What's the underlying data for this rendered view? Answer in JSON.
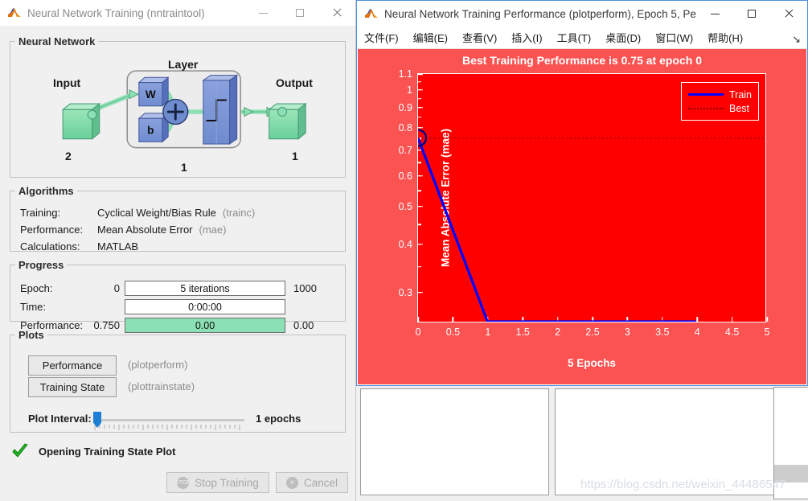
{
  "left_window": {
    "title": "Neural Network Training (nntraintool)",
    "icon": "matlab-icon",
    "controls": {
      "minimize": "—",
      "maximize": "□",
      "close": "✕"
    },
    "nn_group": {
      "legend": "Neural Network",
      "layer_label": "Layer",
      "input_label": "Input",
      "input_count": "2",
      "output_label": "Output",
      "output_count": "1",
      "weight_label": "W",
      "bias_label": "b",
      "sum_label": "+",
      "layer_count": "1"
    },
    "algorithms": {
      "legend": "Algorithms",
      "rows": [
        {
          "label": "Training:",
          "value": "Cyclical Weight/Bias Rule",
          "fn": "(trainc)"
        },
        {
          "label": "Performance:",
          "value": "Mean Absolute Error",
          "fn": "(mae)"
        },
        {
          "label": "Calculations:",
          "value": "MATLAB",
          "fn": ""
        }
      ]
    },
    "progress": {
      "legend": "Progress",
      "rows": [
        {
          "label": "Epoch:",
          "left": "0",
          "bar": "5 iterations",
          "right": "1000",
          "filled": false
        },
        {
          "label": "Time:",
          "left": "",
          "bar": "0:00:00",
          "right": "",
          "filled": false
        },
        {
          "label": "Performance:",
          "left": "0.750",
          "bar": "0.00",
          "right": "0.00",
          "filled": true
        }
      ]
    },
    "plots": {
      "legend": "Plots",
      "buttons": [
        {
          "label": "Performance",
          "fn": "(plotperform)"
        },
        {
          "label": "Training State",
          "fn": "(plottrainstate)"
        }
      ],
      "interval_label": "Plot Interval:",
      "interval_value": "1 epochs"
    },
    "status": {
      "icon": "green-check-icon",
      "text": "Opening Training State Plot"
    },
    "bottom_buttons": [
      {
        "label": "Stop Training",
        "icon": "stop-icon",
        "enabled": false
      },
      {
        "label": "Cancel",
        "icon": "cancel-icon",
        "enabled": false
      }
    ]
  },
  "right_window": {
    "title": "Neural Network Training Performance (plotperform), Epoch 5, Pe...",
    "icon": "matlab-icon",
    "controls": {
      "minimize": "—",
      "maximize": "□",
      "close": "✕"
    },
    "menu": [
      "文件(F)",
      "编辑(E)",
      "查看(V)",
      "插入(I)",
      "工具(T)",
      "桌面(D)",
      "窗口(W)",
      "帮助(H)"
    ],
    "menu_overflow": "↘"
  },
  "chart_data": {
    "type": "line",
    "title": "Best Training Performance is 0.75 at epoch 0",
    "xlabel": "5 Epochs",
    "ylabel": "Mean Absolute Error  (mae)",
    "xlim": [
      0,
      5
    ],
    "ylim": [
      0.25,
      1.1
    ],
    "yscale": "log",
    "xticks": [
      "0",
      "0.5",
      "1",
      "1.5",
      "2",
      "2.5",
      "3",
      "3.5",
      "4",
      "4.5",
      "5"
    ],
    "xtick_values": [
      0,
      0.5,
      1,
      1.5,
      2,
      2.5,
      3,
      3.5,
      4,
      4.5,
      5
    ],
    "yticks": [
      "0.3",
      "0.4",
      "0.5",
      "0.6",
      "0.7",
      "0.8",
      "0.9",
      "1",
      "1.1"
    ],
    "ytick_values": [
      0.3,
      0.4,
      0.5,
      0.6,
      0.7,
      0.8,
      0.9,
      1.0,
      1.1
    ],
    "grid": false,
    "legend_position": "upper-right",
    "plot_bg_color": "#ff0000",
    "figure_bg_color": "#fb5252",
    "series": [
      {
        "name": "Train",
        "color": "#0000ff",
        "style": "solid",
        "x": [
          0,
          1,
          2,
          3,
          4
        ],
        "y": [
          0.75,
          0.25,
          0.25,
          0.25,
          0.25
        ]
      },
      {
        "name": "Best",
        "color": "#8b0000",
        "style": "dotted",
        "x": [
          0,
          5
        ],
        "y": [
          0.75,
          0.75
        ]
      }
    ],
    "markers": [
      {
        "name": "best-marker",
        "x": 0,
        "y": 0.75,
        "shape": "circle",
        "color": "#00008b"
      }
    ]
  },
  "background": {
    "watermark": "https://blog.csdn.net/weixin_44486547"
  }
}
